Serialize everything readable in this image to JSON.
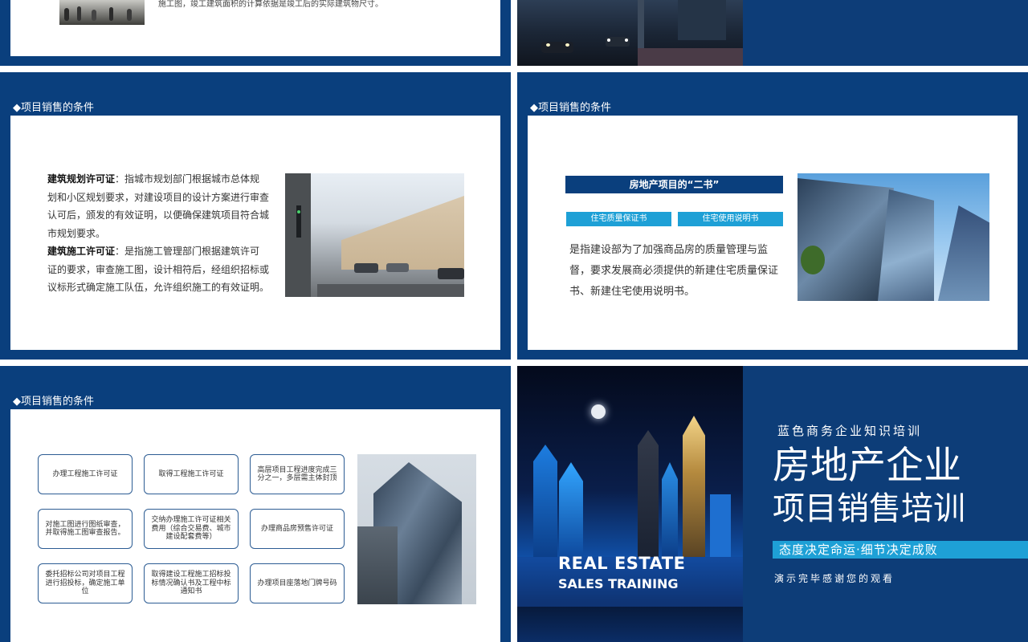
{
  "slides": {
    "top_left": {
      "text": "施工图，竣工建筑面积的计算依据是竣工后的实际建筑物尺寸。"
    },
    "mid_left": {
      "section_title": "◆项目销售的条件",
      "para1_label": "建筑规划许可证",
      "para1_text": "：指城市规划部门根据城市总体规划和小区规划要求，对建设项目的设计方案进行审查认可后，颁发的有效证明，以便确保建筑项目符合城市规划要求。",
      "para2_label": "建筑施工许可证",
      "para2_text": "：是指施工管理部门根据建筑许可证的要求，审查施工图，设计相符后，经组织招标或议标形式确定施工队伍，允许组织施工的有效证明。"
    },
    "mid_right": {
      "section_title": "◆项目销售的条件",
      "banner": "房地产项目的“二书”",
      "tag1": "住宅质量保证书",
      "tag2": "住宅使用说明书",
      "desc": "是指建设部为了加强商品房的质量管理与监督，要求发展商必须提供的新建住宅质量保证书、新建住宅使用说明书。"
    },
    "bottom_left": {
      "section_title": "◆项目销售的条件",
      "steps": [
        "办理工程施工许可证",
        "取得工程施工许可证",
        "高层项目工程进度完成三分之一，多层需主体封顶",
        "对施工图进行图纸审查，并取得施工图审查报告。",
        "交纳办理施工许可证相关费用（综合交易费、城市建设配套费等）",
        "办理商品房预售许可证",
        "委托招标公司对项目工程进行招投标，确定施工单位",
        "取得建设工程施工招标投标情况确认书及工程中标通知书",
        "办理项目座落地门牌号码"
      ]
    },
    "bottom_right": {
      "en_line1": "REAL ESTATE",
      "en_line2": "SALES TRAINING",
      "subtitle": "蓝色商务企业知识培训",
      "title_line1": "房地产企业",
      "title_line2": "项目销售培训",
      "slogan": "态度决定命运·细节决定成败",
      "thanks": "演示完毕感谢您的观看"
    }
  },
  "colors": {
    "navy": "#0a3f7d",
    "accent": "#1ea0d6",
    "white": "#ffffff"
  }
}
